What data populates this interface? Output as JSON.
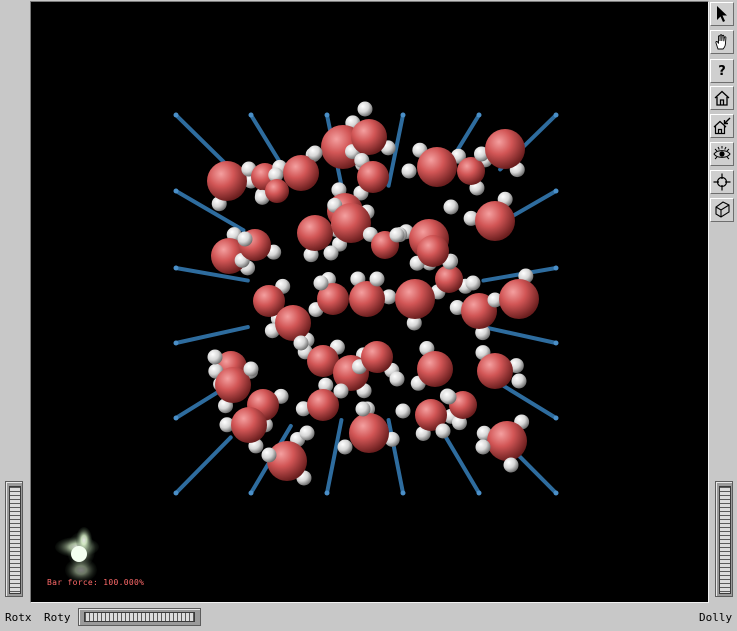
{
  "viewer": {
    "status_text": "Bar force: 100.000%",
    "background_color": "#000000",
    "stick_color": "#2e6c9e",
    "oxygen_color": "#d05050",
    "hydrogen_color": "#dcdcdc"
  },
  "toolbar": [
    {
      "name": "select-arrow-icon"
    },
    {
      "name": "hand-rotate-icon"
    },
    {
      "name": "help-icon",
      "label": "?"
    },
    {
      "name": "home-icon"
    },
    {
      "name": "set-home-icon"
    },
    {
      "name": "view-all-eye-icon"
    },
    {
      "name": "seek-crosshair-icon"
    },
    {
      "name": "perspective-cube-icon"
    }
  ],
  "wheels": {
    "rotx_label": "Rotx",
    "roty_label": "Roty",
    "dolly_label": "Dolly"
  }
}
